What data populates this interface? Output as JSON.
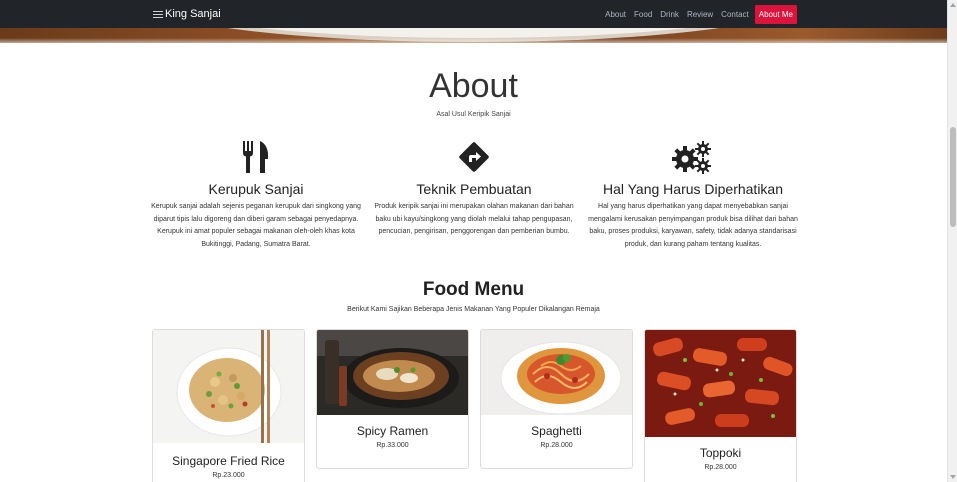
{
  "navbar": {
    "brand": "King Sanjai",
    "links": [
      {
        "label": "About",
        "active": false
      },
      {
        "label": "Food",
        "active": false
      },
      {
        "label": "Drink",
        "active": false
      },
      {
        "label": "Review",
        "active": false
      },
      {
        "label": "Contact",
        "active": false
      },
      {
        "label": "About Me",
        "active": true
      }
    ],
    "accent_color": "#dc143c",
    "background_color": "#212529"
  },
  "about": {
    "title": "About",
    "subtitle": "Asal Usul Keripik Sanjai",
    "columns": [
      {
        "icon": "utensils-icon",
        "heading": "Kerupuk Sanjai",
        "text": "Kerupuk sanjai adalah sejenis peganan kerupuk dari singkong yang diparut tipis lalu digoreng dan diberi garam sebagai penyedapnya. Kerupuk ini amat populer sebagai makanan oleh-oleh khas kota Bukitinggi, Padang, Sumatra Barat."
      },
      {
        "icon": "directions-icon",
        "heading": "Teknik Pembuatan",
        "text": "Produk keripik sanjai ini merupakan olahan makanan dari bahan baku ubi kayu/singkong yang diolah melalui tahap pengupasan, pencucian, pengirisan, penggorengan dan pemberian bumbu."
      },
      {
        "icon": "cogs-icon",
        "heading": "Hal Yang Harus Diperhatikan",
        "text": "Hal yang harus diperhatikan yang dapat menyebabkan sanjai mengalami kerusakan penyimpangan produk bisa dilihat dari bahan baku, proses produksi, karyawan, safety, tidak adanya standarisasi produk, dan kurang paham tentang kualitas."
      }
    ]
  },
  "food_menu": {
    "title": "Food Menu",
    "subtitle": "Berikut Kami Sajikan Beberapa Jenis Makanan Yang Populer Dikalangan Remaja",
    "items": [
      {
        "name": "Singapore Fried Rice",
        "price": "Rp.23.000"
      },
      {
        "name": "Spicy Ramen",
        "price": "Rp.33.000"
      },
      {
        "name": "Spaghetti",
        "price": "Rp.28.000"
      },
      {
        "name": "Toppoki",
        "price": "Rp.28.000"
      }
    ]
  }
}
